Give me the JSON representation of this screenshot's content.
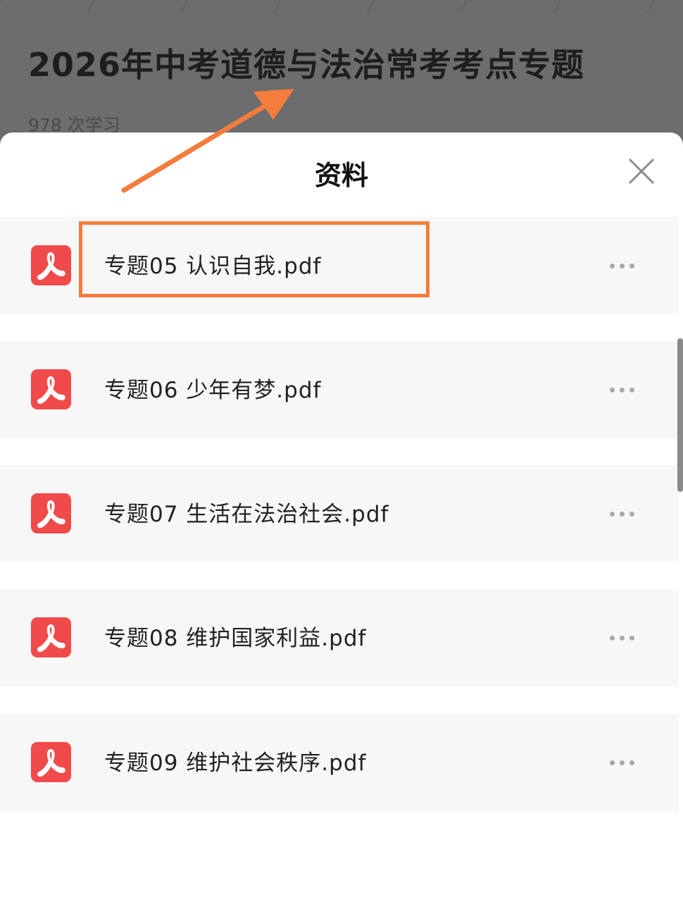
{
  "background": {
    "title": "2026年中考道德与法治常考考点专题",
    "views": "978 次学习"
  },
  "sheet": {
    "title": "资料",
    "close_icon": "close-icon"
  },
  "files": [
    {
      "name": "专题05 认识自我.pdf",
      "icon": "pdf-icon",
      "highlighted": true
    },
    {
      "name": "专题06 少年有梦.pdf",
      "icon": "pdf-icon"
    },
    {
      "name": "专题07 生活在法治社会.pdf",
      "icon": "pdf-icon"
    },
    {
      "name": "专题08 维护国家利益.pdf",
      "icon": "pdf-icon"
    },
    {
      "name": "专题09 维护社会秩序.pdf",
      "icon": "pdf-icon"
    }
  ],
  "colors": {
    "pdf_red": "#f04a4a",
    "annotation_orange": "#f47c3c",
    "overlay_gray": "#6d6d6d"
  }
}
